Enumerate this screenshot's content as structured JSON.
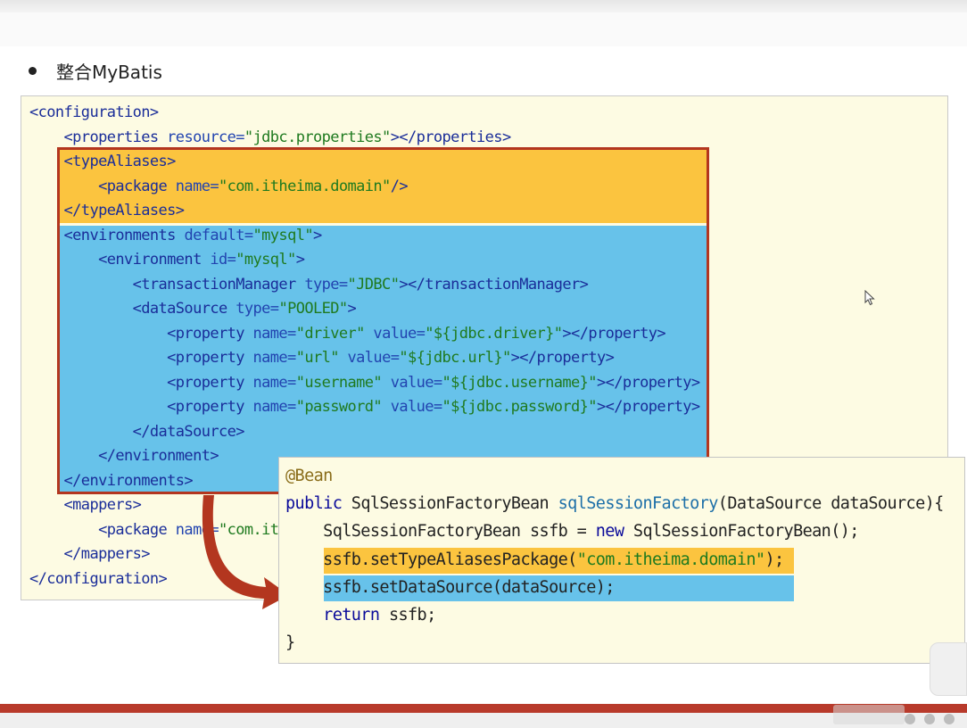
{
  "bullet": {
    "text": "整合MyBatis"
  },
  "xml": {
    "lines": [
      [
        {
          "t": "<configuration>",
          "c": "tg"
        }
      ],
      [
        {
          "t": "    <properties ",
          "c": "tg"
        },
        {
          "t": "resource=",
          "c": "at"
        },
        {
          "t": "\"jdbc.properties\"",
          "c": "av"
        },
        {
          "t": "></properties>",
          "c": "tg"
        }
      ],
      [
        {
          "t": "    <typeAliases>",
          "c": "tg"
        }
      ],
      [
        {
          "t": "        <package ",
          "c": "tg"
        },
        {
          "t": "name=",
          "c": "at"
        },
        {
          "t": "\"com.itheima.domain\"",
          "c": "av"
        },
        {
          "t": "/>",
          "c": "tg"
        }
      ],
      [
        {
          "t": "    </typeAliases>",
          "c": "tg"
        }
      ],
      [
        {
          "t": "    <environments ",
          "c": "tg"
        },
        {
          "t": "default=",
          "c": "at"
        },
        {
          "t": "\"mysql\"",
          "c": "av"
        },
        {
          "t": ">",
          "c": "tg"
        }
      ],
      [
        {
          "t": "        <environment ",
          "c": "tg"
        },
        {
          "t": "id=",
          "c": "at"
        },
        {
          "t": "\"mysql\"",
          "c": "av"
        },
        {
          "t": ">",
          "c": "tg"
        }
      ],
      [
        {
          "t": "            <transactionManager ",
          "c": "tg"
        },
        {
          "t": "type=",
          "c": "at"
        },
        {
          "t": "\"JDBC\"",
          "c": "av"
        },
        {
          "t": "></transactionManager>",
          "c": "tg"
        }
      ],
      [
        {
          "t": "            <dataSource ",
          "c": "tg"
        },
        {
          "t": "type=",
          "c": "at"
        },
        {
          "t": "\"POOLED\"",
          "c": "av"
        },
        {
          "t": ">",
          "c": "tg"
        }
      ],
      [
        {
          "t": "                <property ",
          "c": "tg"
        },
        {
          "t": "name=",
          "c": "at"
        },
        {
          "t": "\"driver\"",
          "c": "av"
        },
        {
          "t": " value=",
          "c": "at"
        },
        {
          "t": "\"${jdbc.driver}\"",
          "c": "av"
        },
        {
          "t": "></property>",
          "c": "tg"
        }
      ],
      [
        {
          "t": "                <property ",
          "c": "tg"
        },
        {
          "t": "name=",
          "c": "at"
        },
        {
          "t": "\"url\"",
          "c": "av"
        },
        {
          "t": " value=",
          "c": "at"
        },
        {
          "t": "\"${jdbc.url}\"",
          "c": "av"
        },
        {
          "t": "></property>",
          "c": "tg"
        }
      ],
      [
        {
          "t": "                <property ",
          "c": "tg"
        },
        {
          "t": "name=",
          "c": "at"
        },
        {
          "t": "\"username\"",
          "c": "av"
        },
        {
          "t": " value=",
          "c": "at"
        },
        {
          "t": "\"${jdbc.username}\"",
          "c": "av"
        },
        {
          "t": "></property>",
          "c": "tg"
        }
      ],
      [
        {
          "t": "                <property ",
          "c": "tg"
        },
        {
          "t": "name=",
          "c": "at"
        },
        {
          "t": "\"password\"",
          "c": "av"
        },
        {
          "t": " value=",
          "c": "at"
        },
        {
          "t": "\"${jdbc.password}\"",
          "c": "av"
        },
        {
          "t": "></property>",
          "c": "tg"
        }
      ],
      [
        {
          "t": "            </dataSource>",
          "c": "tg"
        }
      ],
      [
        {
          "t": "        </environment>",
          "c": "tg"
        }
      ],
      [
        {
          "t": "    </environments>",
          "c": "tg"
        }
      ],
      [
        {
          "t": "    <mappers>",
          "c": "tg"
        }
      ],
      [
        {
          "t": "        <package ",
          "c": "tg"
        },
        {
          "t": "name=",
          "c": "at"
        },
        {
          "t": "\"com.ith",
          "c": "av"
        }
      ],
      [
        {
          "t": "    </mappers>",
          "c": "tg"
        }
      ],
      [
        {
          "t": "</configuration>",
          "c": "tg"
        }
      ]
    ]
  },
  "java": {
    "lines": [
      [
        {
          "t": "@Bean",
          "c": "ann"
        }
      ],
      [
        {
          "t": "public ",
          "c": "kw"
        },
        {
          "t": "SqlSessionFactoryBean ",
          "c": "pl"
        },
        {
          "t": "sqlSessionFactory",
          "c": "mn"
        },
        {
          "t": "(DataSource dataSource){",
          "c": "pl"
        }
      ],
      [
        {
          "t": "    SqlSessionFactoryBean ssfb = ",
          "c": "pl"
        },
        {
          "t": "new ",
          "c": "kw"
        },
        {
          "t": "SqlSessionFactoryBean();",
          "c": "pl"
        }
      ],
      [
        {
          "t": "    ssfb.setTypeAliasesPackage(",
          "c": "pl"
        },
        {
          "t": "\"com.itheima.domain\"",
          "c": "str"
        },
        {
          "t": ");",
          "c": "pl"
        }
      ],
      [
        {
          "t": "    ssfb.setDataSource(dataSource);",
          "c": "pl"
        }
      ],
      [
        {
          "t": "    ",
          "c": "pl"
        },
        {
          "t": "return ",
          "c": "kw"
        },
        {
          "t": "ssfb;",
          "c": "pl"
        }
      ],
      [
        {
          "t": "}",
          "c": "pl"
        }
      ]
    ]
  },
  "colors": {
    "yellow_highlight": "#fbc43f",
    "blue_highlight": "#67c2ea",
    "red_frame": "#b3361f",
    "panel_bg": "#fdfbe3"
  }
}
